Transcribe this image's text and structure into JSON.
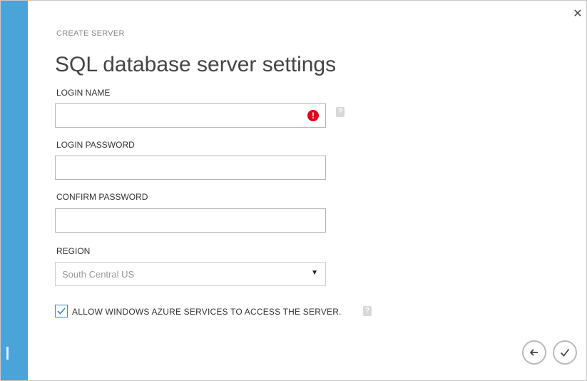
{
  "header": {
    "breadcrumb": "CREATE SERVER",
    "title": "SQL database server settings"
  },
  "form": {
    "login_name": {
      "label": "LOGIN NAME",
      "value": ""
    },
    "login_password": {
      "label": "LOGIN PASSWORD",
      "value": ""
    },
    "confirm_password": {
      "label": "CONFIRM PASSWORD",
      "value": ""
    },
    "region": {
      "label": "REGION",
      "selected": "South Central US"
    },
    "allow_azure": {
      "label": "ALLOW WINDOWS AZURE SERVICES TO ACCESS THE SERVER.",
      "checked": true
    }
  },
  "icons": {
    "close": "close-icon",
    "error": "error-icon",
    "help": "help-icon",
    "back": "back-arrow-icon",
    "finish": "checkmark-icon"
  },
  "colors": {
    "accent_bar": "#4aa3d9",
    "error": "#e0001b",
    "checkbox_border": "#3a86c8"
  }
}
